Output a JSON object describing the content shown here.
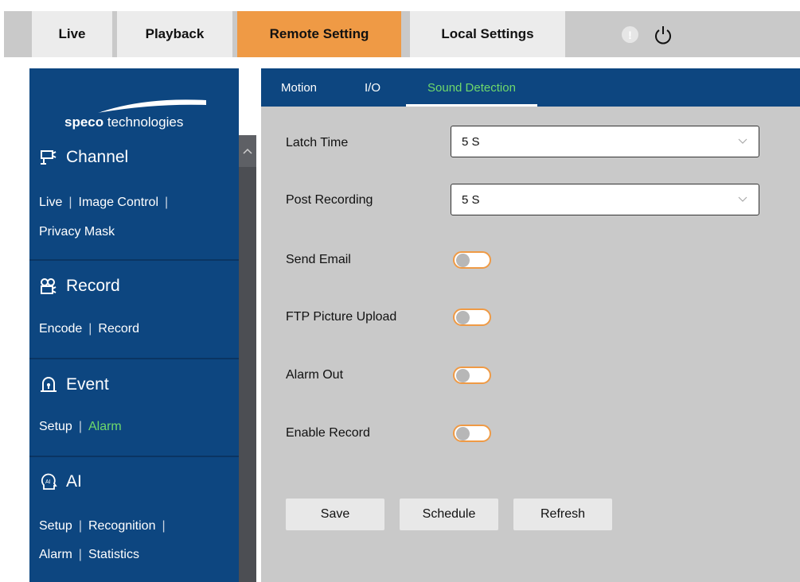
{
  "top_tabs": [
    {
      "label": "Live"
    },
    {
      "label": "Playback"
    },
    {
      "label": "Remote Setting",
      "active": true
    },
    {
      "label": "Local Settings"
    }
  ],
  "top_icons": {
    "alert": "!",
    "alert_icon": "alert-icon",
    "power_icon": "power-icon"
  },
  "logo": {
    "brand": "speco",
    "rest": " technologies"
  },
  "sidebar": {
    "channel": {
      "title": "Channel",
      "links": [
        "Live",
        "Image Control",
        "Privacy Mask"
      ]
    },
    "record": {
      "title": "Record",
      "links": [
        "Encode",
        "Record"
      ]
    },
    "event": {
      "title": "Event",
      "links": [
        "Setup",
        "Alarm"
      ],
      "active_link": "Alarm"
    },
    "ai": {
      "title": "AI",
      "links": [
        "Setup",
        "Recognition",
        "Alarm",
        "Statistics"
      ]
    }
  },
  "subtabs": [
    {
      "label": "Motion"
    },
    {
      "label": "I/O"
    },
    {
      "label": "Sound Detection",
      "active": true
    }
  ],
  "form": {
    "latch_time": {
      "label": "Latch Time",
      "value": "5 S"
    },
    "post_recording": {
      "label": "Post Recording",
      "value": "5 S"
    },
    "send_email": {
      "label": "Send Email",
      "on": false
    },
    "ftp_upload": {
      "label": "FTP Picture Upload",
      "on": false
    },
    "alarm_out": {
      "label": "Alarm Out",
      "on": false
    },
    "enable_record": {
      "label": "Enable Record",
      "on": false
    }
  },
  "buttons": {
    "save": "Save",
    "schedule": "Schedule",
    "refresh": "Refresh"
  },
  "colors": {
    "accent": "#ef9a45",
    "nav_blue": "#0d4680",
    "active_green": "#6fd96b",
    "panel_gray": "#c9c9c9"
  }
}
